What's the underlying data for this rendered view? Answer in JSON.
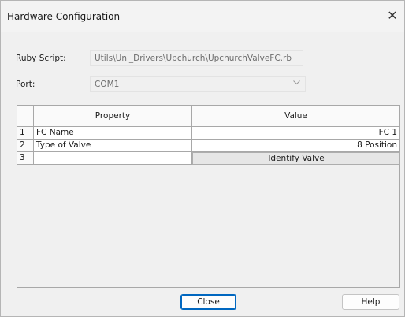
{
  "window": {
    "title": "Hardware Configuration",
    "close_glyph": "✕"
  },
  "form": {
    "ruby_script_label_mnemonic": "R",
    "ruby_script_label_rest": "uby Script:",
    "ruby_script_value": "Utils\\Uni_Drivers\\Upchurch\\UpchurchValveFC.rb",
    "port_label_mnemonic": "P",
    "port_label_rest": "ort:",
    "port_value": "COM1"
  },
  "grid": {
    "headers": {
      "property": "Property",
      "value": "Value"
    },
    "rows": [
      {
        "num": "1",
        "property": "FC Name",
        "value": "FC 1"
      },
      {
        "num": "2",
        "property": "Type of Valve",
        "value": "8 Position"
      },
      {
        "num": "3",
        "property": "",
        "value_button": "Identify Valve"
      }
    ]
  },
  "buttons": {
    "close": "Close",
    "help": "Help"
  },
  "icons": {
    "window_close": "close-icon",
    "dropdown": "chevron-down-icon"
  }
}
